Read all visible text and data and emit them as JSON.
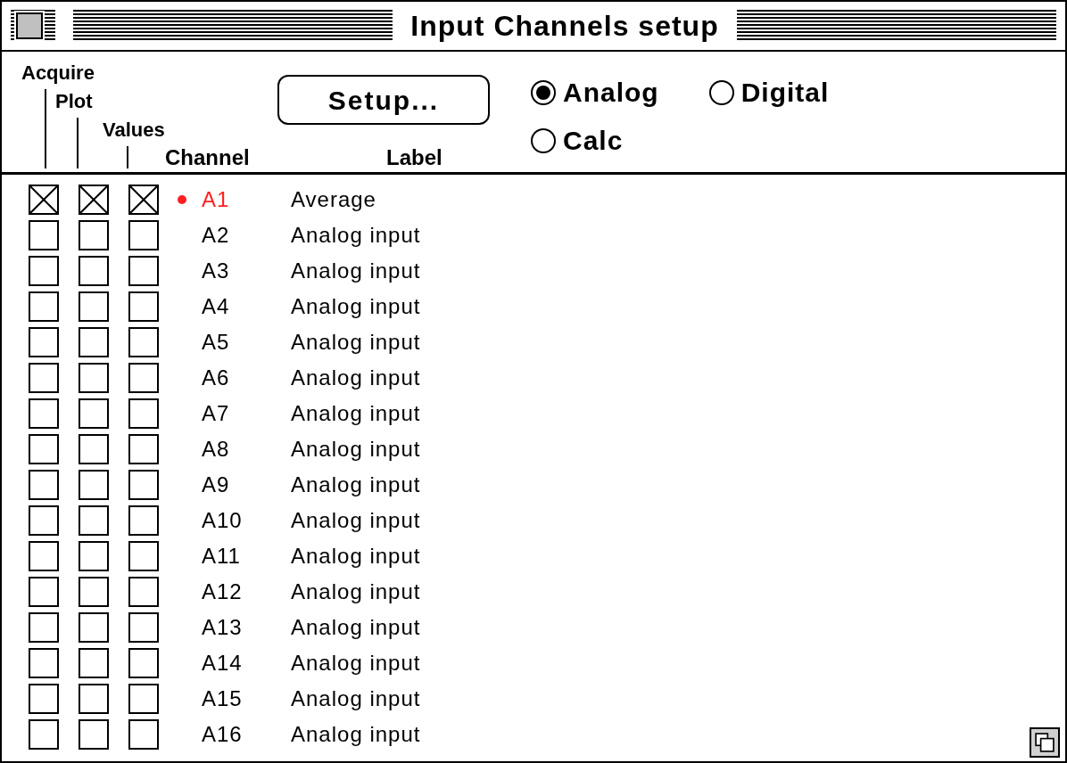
{
  "window": {
    "title": "Input Channels setup"
  },
  "columns": {
    "acquire": "Acquire",
    "plot": "Plot",
    "values": "Values",
    "channel": "Channel",
    "label": "Label"
  },
  "setup_button": "Setup...",
  "source_options": [
    {
      "label": "Analog",
      "selected": true
    },
    {
      "label": "Digital",
      "selected": false
    },
    {
      "label": "Calc",
      "selected": false
    }
  ],
  "channels": [
    {
      "channel": "A1",
      "label": "Average",
      "acquire": true,
      "plot": true,
      "values": true,
      "selected": true
    },
    {
      "channel": "A2",
      "label": "Analog input",
      "acquire": false,
      "plot": false,
      "values": false,
      "selected": false
    },
    {
      "channel": "A3",
      "label": "Analog input",
      "acquire": false,
      "plot": false,
      "values": false,
      "selected": false
    },
    {
      "channel": "A4",
      "label": "Analog input",
      "acquire": false,
      "plot": false,
      "values": false,
      "selected": false
    },
    {
      "channel": "A5",
      "label": "Analog input",
      "acquire": false,
      "plot": false,
      "values": false,
      "selected": false
    },
    {
      "channel": "A6",
      "label": "Analog input",
      "acquire": false,
      "plot": false,
      "values": false,
      "selected": false
    },
    {
      "channel": "A7",
      "label": "Analog input",
      "acquire": false,
      "plot": false,
      "values": false,
      "selected": false
    },
    {
      "channel": "A8",
      "label": "Analog input",
      "acquire": false,
      "plot": false,
      "values": false,
      "selected": false
    },
    {
      "channel": "A9",
      "label": "Analog input",
      "acquire": false,
      "plot": false,
      "values": false,
      "selected": false
    },
    {
      "channel": "A10",
      "label": "Analog input",
      "acquire": false,
      "plot": false,
      "values": false,
      "selected": false
    },
    {
      "channel": "A11",
      "label": "Analog input",
      "acquire": false,
      "plot": false,
      "values": false,
      "selected": false
    },
    {
      "channel": "A12",
      "label": "Analog input",
      "acquire": false,
      "plot": false,
      "values": false,
      "selected": false
    },
    {
      "channel": "A13",
      "label": "Analog input",
      "acquire": false,
      "plot": false,
      "values": false,
      "selected": false
    },
    {
      "channel": "A14",
      "label": "Analog input",
      "acquire": false,
      "plot": false,
      "values": false,
      "selected": false
    },
    {
      "channel": "A15",
      "label": "Analog input",
      "acquire": false,
      "plot": false,
      "values": false,
      "selected": false
    },
    {
      "channel": "A16",
      "label": "Analog input",
      "acquire": false,
      "plot": false,
      "values": false,
      "selected": false
    }
  ]
}
